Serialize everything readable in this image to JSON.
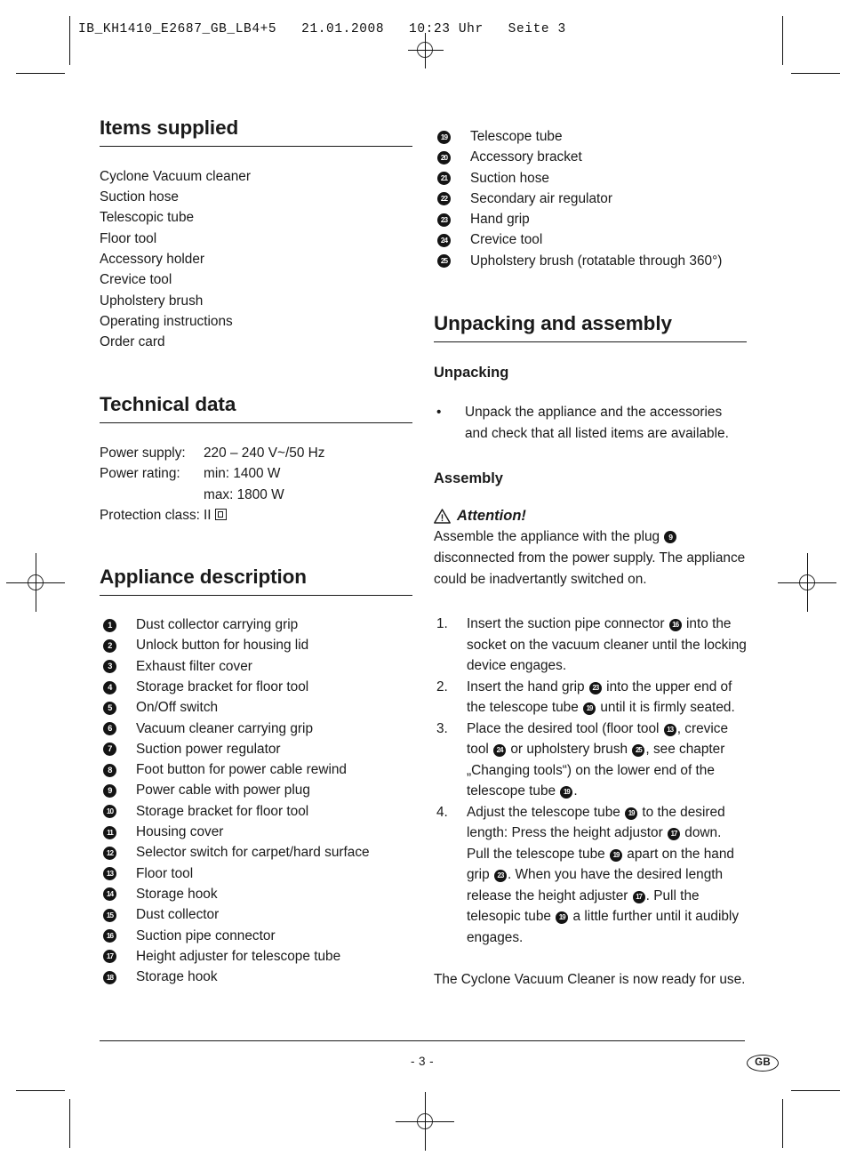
{
  "document": {
    "header_line": "IB_KH1410_E2687_GB_LB4+5   21.01.2008   10:23 Uhr   Seite 3",
    "page_number": "- 3 -",
    "language_badge": "GB"
  },
  "left_column": {
    "items_supplied": {
      "heading": "Items supplied",
      "items": [
        "Cyclone Vacuum cleaner",
        "Suction hose",
        "Telescopic tube",
        "Floor tool",
        "Accessory holder",
        "Crevice tool",
        "Upholstery brush",
        "Operating instructions",
        "Order card"
      ]
    },
    "technical_data": {
      "heading": "Technical data",
      "rows": [
        {
          "label": "Power supply:",
          "value": "220 – 240 V~/50 Hz"
        },
        {
          "label": "Power rating:",
          "value": "min: 1400 W"
        },
        {
          "label": "",
          "value": "max: 1800 W"
        },
        {
          "label": "Protection class:",
          "value": "II",
          "icon": "class-2-double-square-icon"
        }
      ]
    },
    "appliance_description": {
      "heading": "Appliance description",
      "items": [
        {
          "n": "1",
          "label": "Dust collector carrying grip"
        },
        {
          "n": "2",
          "label": "Unlock button for housing lid"
        },
        {
          "n": "3",
          "label": "Exhaust filter cover"
        },
        {
          "n": "4",
          "label": "Storage bracket for floor tool"
        },
        {
          "n": "5",
          "label": "On/Off switch"
        },
        {
          "n": "6",
          "label": "Vacuum cleaner carrying grip"
        },
        {
          "n": "7",
          "label": "Suction power regulator"
        },
        {
          "n": "8",
          "label": "Foot button for power cable rewind"
        },
        {
          "n": "9",
          "label": "Power cable with power plug"
        },
        {
          "n": "10",
          "label": "Storage bracket for floor tool"
        },
        {
          "n": "11",
          "label": "Housing cover"
        },
        {
          "n": "12",
          "label": "Selector switch for carpet/hard surface"
        },
        {
          "n": "13",
          "label": "Floor tool"
        },
        {
          "n": "14",
          "label": "Storage hook"
        },
        {
          "n": "15",
          "label": "Dust collector"
        },
        {
          "n": "16",
          "label": "Suction pipe connector"
        },
        {
          "n": "17",
          "label": "Height adjuster for telescope tube"
        },
        {
          "n": "18",
          "label": "Storage hook"
        }
      ]
    }
  },
  "right_column": {
    "appliance_description_continued": [
      {
        "n": "19",
        "label": "Telescope tube"
      },
      {
        "n": "20",
        "label": "Accessory bracket"
      },
      {
        "n": "21",
        "label": "Suction hose"
      },
      {
        "n": "22",
        "label": "Secondary air regulator"
      },
      {
        "n": "23",
        "label": "Hand grip"
      },
      {
        "n": "24",
        "label": "Crevice tool"
      },
      {
        "n": "25",
        "label": "Upholstery brush (rotatable through 360°)"
      }
    ],
    "unpacking_and_assembly": {
      "heading": "Unpacking and assembly",
      "unpacking": {
        "heading": "Unpacking",
        "bullet": "Unpack the appliance and the accessories and check that all listed items are available."
      },
      "assembly": {
        "heading": "Assembly",
        "attention": {
          "icon": "warning-triangle-icon",
          "title": "Attention!",
          "body_part_1": "Assemble the appliance with the plug ",
          "body_ref": "9",
          "body_part_2": " disconnected from the power supply. The appliance could be inadvertantly switched on."
        },
        "steps": [
          {
            "no": "1.",
            "segments": [
              {
                "text": "Insert the suction pipe connector "
              },
              {
                "ref": "16"
              },
              {
                "text": " into the socket on the vacuum cleaner until the locking device engages."
              }
            ]
          },
          {
            "no": "2.",
            "segments": [
              {
                "text": "Insert the hand grip "
              },
              {
                "ref": "23"
              },
              {
                "text": " into the upper end of the telescope tube "
              },
              {
                "ref": "19"
              },
              {
                "text": " until it is firmly seated."
              }
            ]
          },
          {
            "no": "3.",
            "segments": [
              {
                "text": "Place the desired tool (floor tool "
              },
              {
                "ref": "13"
              },
              {
                "text": ", crevice tool "
              },
              {
                "ref": "24"
              },
              {
                "text": " or upholstery brush "
              },
              {
                "ref": "25"
              },
              {
                "text": ", see chapter „Changing tools“) on the lower end of the telescope tube "
              },
              {
                "ref": "19"
              },
              {
                "text": "."
              }
            ]
          },
          {
            "no": "4.",
            "segments": [
              {
                "text": "Adjust the telescope tube "
              },
              {
                "ref": "19"
              },
              {
                "text": " to the desired length: Press the height adjustor "
              },
              {
                "ref": "17"
              },
              {
                "text": " down. Pull the telescope tube "
              },
              {
                "ref": "19"
              },
              {
                "text": " apart on the hand grip "
              },
              {
                "ref": "23"
              },
              {
                "text": ". When you have the desired length release the height adjuster "
              },
              {
                "ref": "17"
              },
              {
                "text": ". Pull the telesopic tube "
              },
              {
                "ref": "19"
              },
              {
                "text": " a little further until it audibly engages."
              }
            ]
          }
        ],
        "closing": "The Cyclone Vacuum Cleaner is now ready for use."
      }
    }
  }
}
